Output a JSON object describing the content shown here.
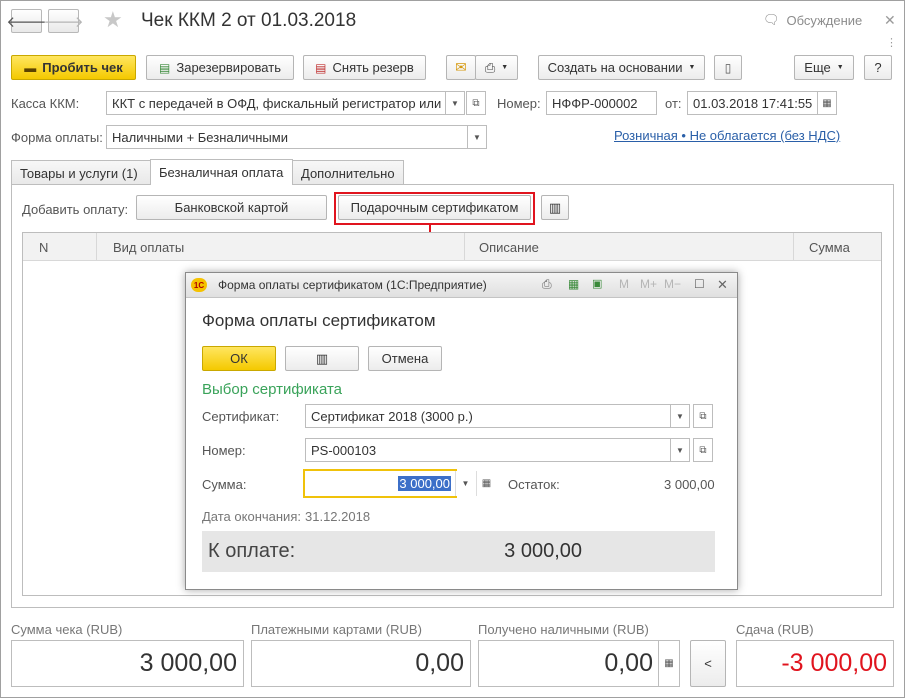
{
  "window": {
    "title": "Чек ККМ 2 от 01.03.2018",
    "discuss_label": "Обсуждение",
    "back_icon": "arrow-left-icon",
    "forward_icon": "arrow-right-icon",
    "favorite_icon": "star-icon"
  },
  "toolbar": {
    "punch_label": "Пробить чек",
    "reserve_label": "Зарезервировать",
    "unreserve_label": "Снять резерв",
    "create_based_label": "Создать на основании",
    "more_label": "Еще",
    "help_label": "?"
  },
  "form": {
    "kassa_label": "Касса ККМ:",
    "kassa_value": "ККТ с передачей в ОФД, фискальный регистратор или",
    "number_label": "Номер:",
    "number_value": "НФФР-000002",
    "date_label": "от:",
    "date_value": "01.03.2018 17:41:55",
    "payform_label": "Форма оплаты:",
    "payform_value": "Наличными + Безналичными",
    "tax_link": "Розничная • Не облагается (без НДС)"
  },
  "tabs": [
    {
      "label": "Товары и услуги (1)"
    },
    {
      "label": "Безналичная оплата"
    },
    {
      "label": "Дополнительно"
    }
  ],
  "payment": {
    "add_label": "Добавить оплату:",
    "bank_card_label": "Банковской картой",
    "gift_cert_label": "Подарочным сертификатом"
  },
  "table": {
    "columns": [
      "N",
      "Вид оплаты",
      "Описание",
      "Сумма"
    ]
  },
  "dialog": {
    "window_title": "Форма оплаты сертификатом  (1С:Предприятие)",
    "heading": "Форма оплаты сертификатом",
    "ok_label": "ОК",
    "cancel_label": "Отмена",
    "group_title": "Выбор сертификата",
    "cert_label": "Сертификат:",
    "cert_value": "Сертификат 2018 (3000 р.)",
    "num_label": "Номер:",
    "num_value": "PS-000103",
    "sum_label": "Сумма:",
    "sum_value": "3 000,00",
    "balance_label": "Остаток:",
    "balance_value": "3 000,00",
    "expiry_label": "Дата окончания:",
    "expiry_value": "31.12.2018",
    "to_pay_label": "К оплате:",
    "to_pay_value": "3 000,00",
    "m_label": "M",
    "mplus_label": "M+",
    "mminus_label": "M−"
  },
  "totals": {
    "check_sum_label": "Сумма чека (RUB)",
    "check_sum_value": "3 000,00",
    "cards_label": "Платежными картами (RUB)",
    "cards_value": "0,00",
    "cash_label": "Получено наличными (RUB)",
    "cash_value": "0,00",
    "change_label": "Сдача (RUB)",
    "change_value": "-3 000,00",
    "back_button": "<"
  },
  "colors": {
    "accent_yellow": "#f4c900",
    "highlight_red": "#e0141e",
    "group_green": "#3aa35a",
    "link_blue": "#2a5fa8",
    "negative_red": "#e0141e"
  }
}
